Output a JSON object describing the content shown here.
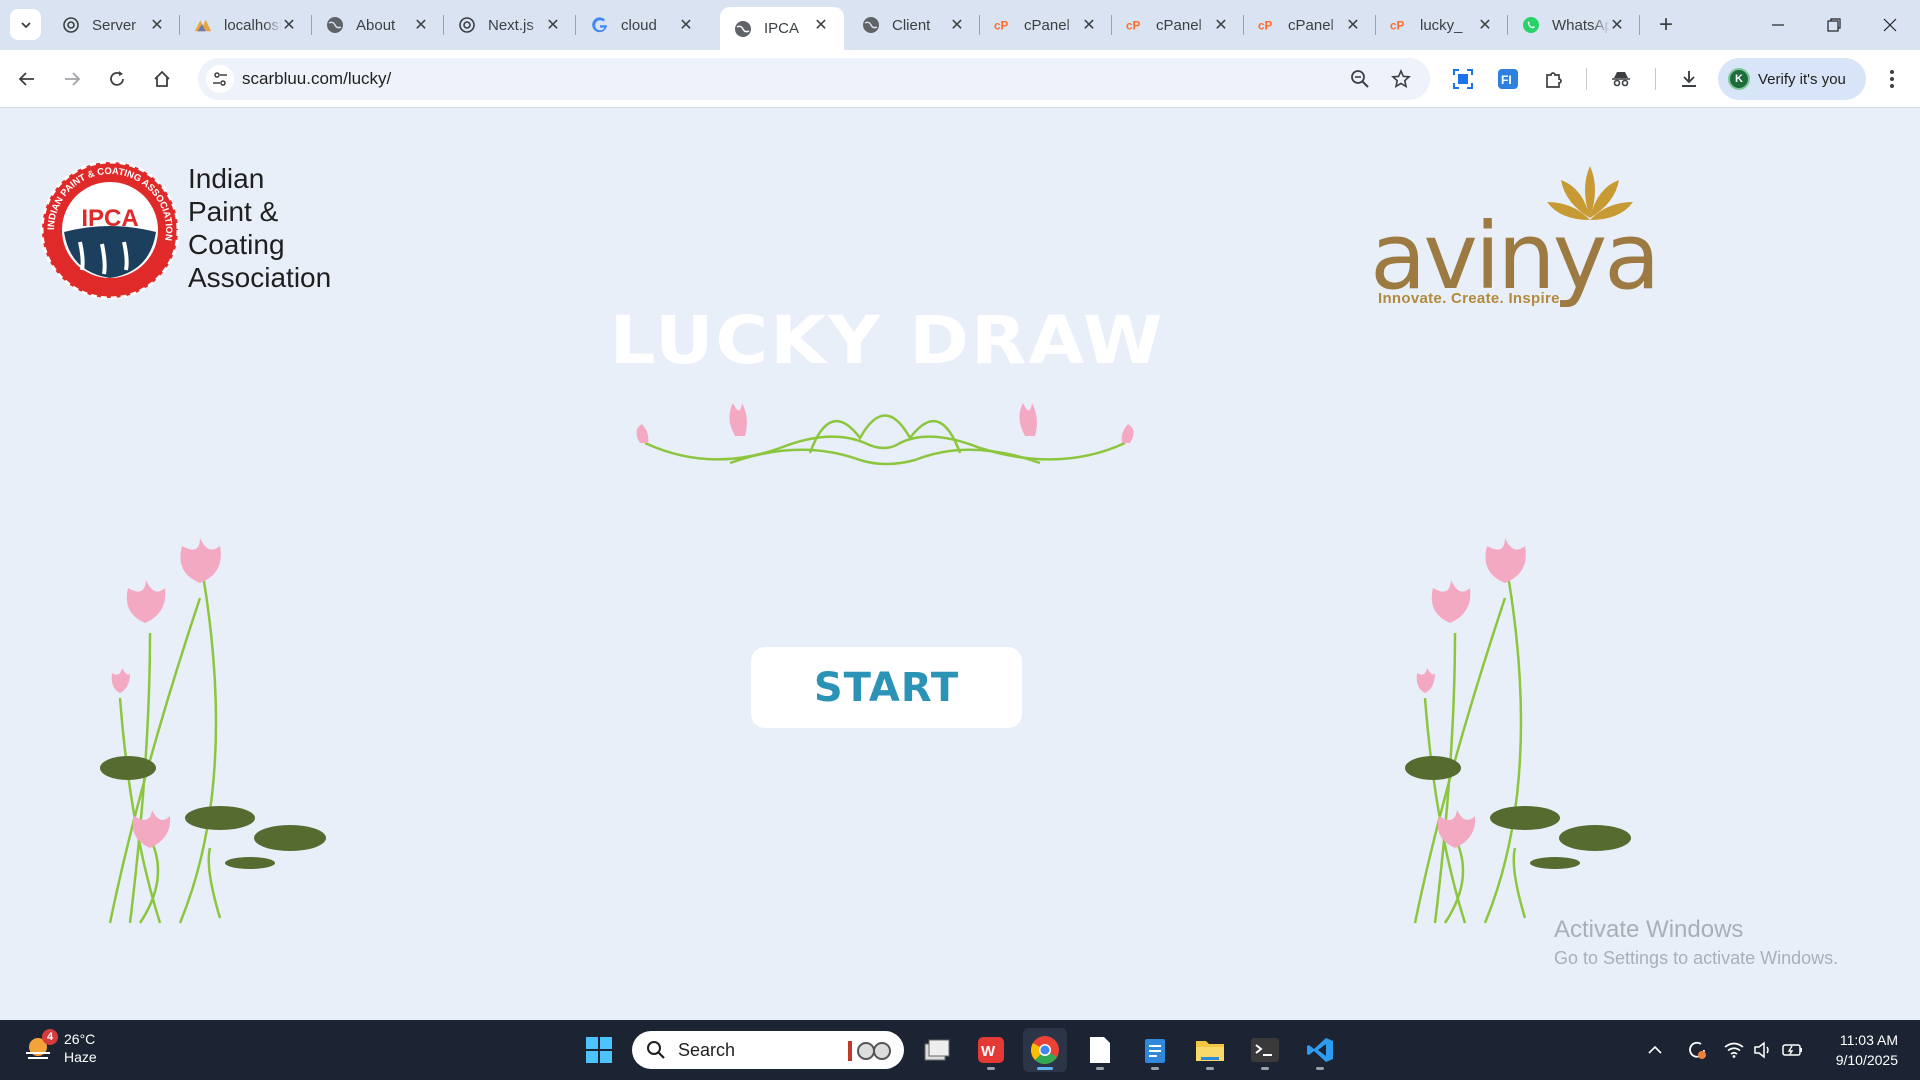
{
  "tabs": [
    {
      "title": "Server",
      "icon": "openai-icon"
    },
    {
      "title": "localhost",
      "icon": "phpmyadmin-icon"
    },
    {
      "title": "About",
      "icon": "globe-icon"
    },
    {
      "title": "Next.js",
      "icon": "openai-icon"
    },
    {
      "title": "cloud",
      "icon": "google-icon"
    },
    {
      "title": "IPCA",
      "icon": "globe-icon",
      "active": true
    },
    {
      "title": "Client",
      "icon": "globe-icon"
    },
    {
      "title": "cPanel",
      "icon": "cpanel-icon"
    },
    {
      "title": "cPanel",
      "icon": "cpanel-icon"
    },
    {
      "title": "cPanel",
      "icon": "cpanel-icon"
    },
    {
      "title": "lucky_",
      "icon": "cpanel-icon"
    },
    {
      "title": "WhatsApp",
      "icon": "whatsapp-icon"
    }
  ],
  "address_bar": {
    "url": "scarbluu.com/lucky/"
  },
  "profile": {
    "initial": "K",
    "label": "Verify it's you"
  },
  "page": {
    "ipca": {
      "badge": "IPCA",
      "line1": "Indian",
      "line2": "Paint &",
      "line3": "Coating",
      "line4": "Association",
      "ring_text": "INDIAN PAINT & COATING ASSOCIATION"
    },
    "avinya": {
      "wordmark": "avinya",
      "tagline": "Innovate. Create. Inspire"
    },
    "title": "LUCKY DRAW",
    "start_label": "START"
  },
  "watermark": {
    "line1": "Activate Windows",
    "line2": "Go to Settings to activate Windows."
  },
  "taskbar": {
    "weather": {
      "temp": "26°C",
      "condition": "Haze",
      "badge": "4"
    },
    "search_placeholder": "Search",
    "time": "11:03 AM",
    "date": "9/10/2025"
  },
  "colors": {
    "accent_start_text": "#2b93b6",
    "avinya_gold": "#b28a3c",
    "ipca_red": "#e02a2a",
    "ipca_navy": "#1d3f5e",
    "page_bg": "#e8eff9"
  }
}
